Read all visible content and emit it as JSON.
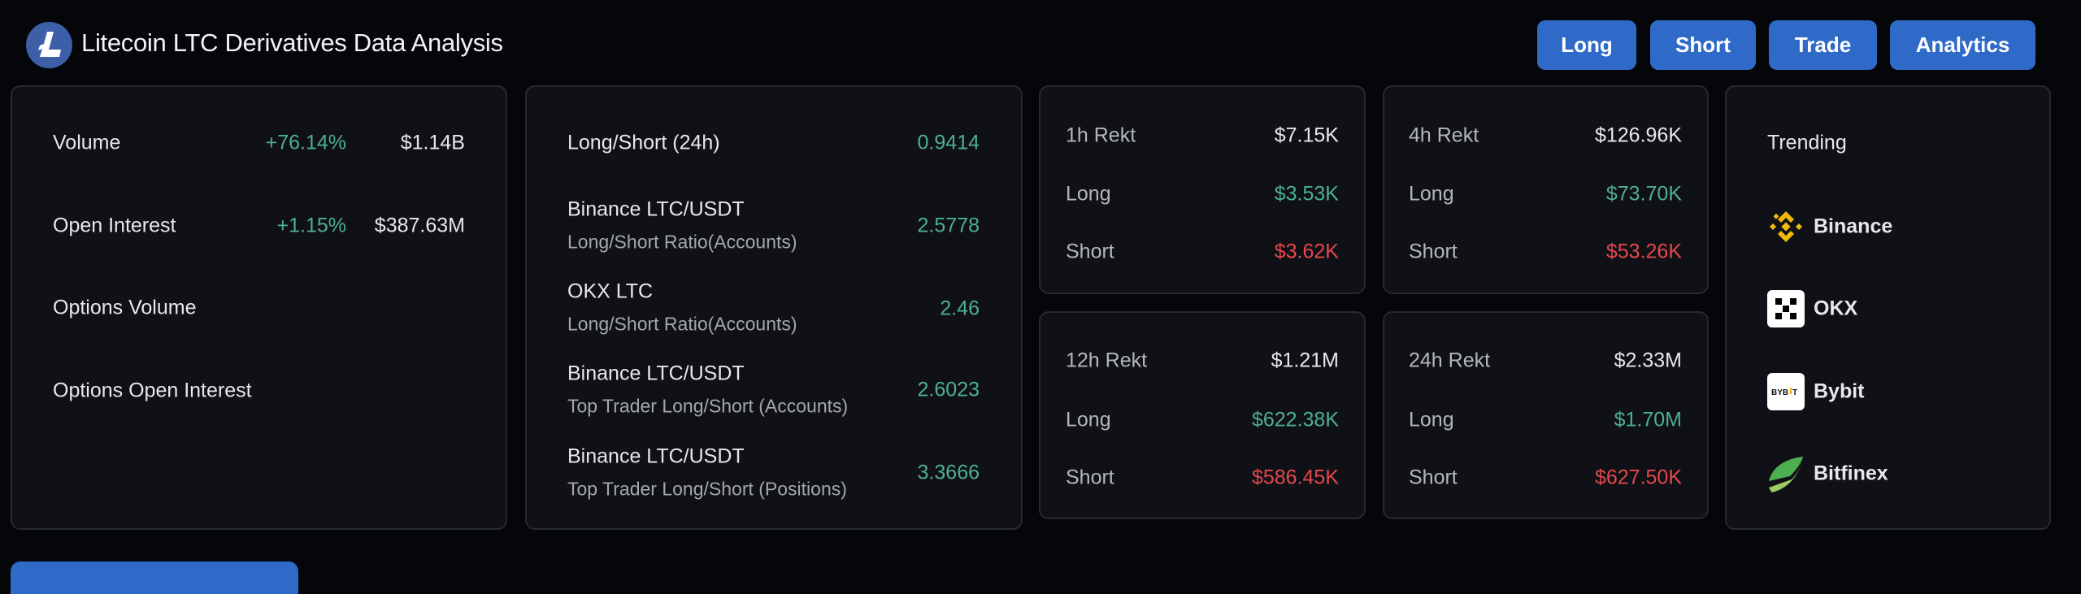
{
  "header": {
    "title": "Litecoin LTC Derivatives Data Analysis",
    "logo_icon": "litecoin-logo-icon",
    "nav_buttons": [
      "Long",
      "Short",
      "Trade",
      "Analytics"
    ]
  },
  "colors": {
    "accent": "#2f6ac8",
    "positive": "#4cb08f",
    "negative": "#e5484d",
    "background": "#05060a",
    "card": "#101116"
  },
  "overview": {
    "rows": [
      {
        "label": "Volume",
        "change": "+76.14%",
        "value": "$1.14B"
      },
      {
        "label": "Open Interest",
        "change": "+1.15%",
        "value": "$387.63M"
      },
      {
        "label": "Options Volume",
        "change": "",
        "value": ""
      },
      {
        "label": "Options Open Interest",
        "change": "",
        "value": ""
      }
    ]
  },
  "ratios": {
    "rows": [
      {
        "title": "Long/Short (24h)",
        "subtitle": "",
        "value": "0.9414"
      },
      {
        "title": "Binance LTC/USDT",
        "subtitle": "Long/Short Ratio(Accounts)",
        "value": "2.5778"
      },
      {
        "title": "OKX LTC",
        "subtitle": "Long/Short Ratio(Accounts)",
        "value": "2.46"
      },
      {
        "title": "Binance LTC/USDT",
        "subtitle": "Top Trader Long/Short (Accounts)",
        "value": "2.6023"
      },
      {
        "title": "Binance LTC/USDT",
        "subtitle": "Top Trader Long/Short (Positions)",
        "value": "3.3666"
      }
    ]
  },
  "rekt": [
    {
      "label": "1h Rekt",
      "total": "$7.15K",
      "long_label": "Long",
      "long": "$3.53K",
      "short_label": "Short",
      "short": "$3.62K"
    },
    {
      "label": "4h Rekt",
      "total": "$126.96K",
      "long_label": "Long",
      "long": "$73.70K",
      "short_label": "Short",
      "short": "$53.26K"
    },
    {
      "label": "12h Rekt",
      "total": "$1.21M",
      "long_label": "Long",
      "long": "$622.38K",
      "short_label": "Short",
      "short": "$586.45K"
    },
    {
      "label": "24h Rekt",
      "total": "$2.33M",
      "long_label": "Long",
      "long": "$1.70M",
      "short_label": "Short",
      "short": "$627.50K"
    }
  ],
  "trending": {
    "title": "Trending",
    "exchanges": [
      {
        "name": "Binance",
        "icon": "binance-icon"
      },
      {
        "name": "OKX",
        "icon": "okx-icon"
      },
      {
        "name": "Bybit",
        "icon": "bybit-icon"
      },
      {
        "name": "Bitfinex",
        "icon": "bitfinex-icon"
      }
    ]
  }
}
